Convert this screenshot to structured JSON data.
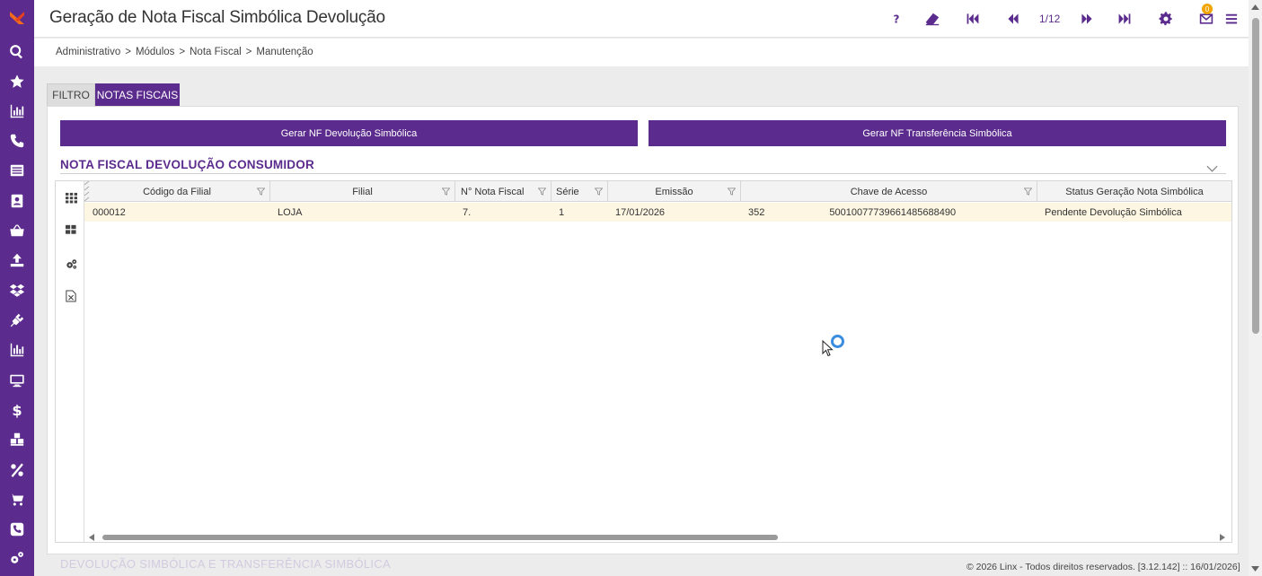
{
  "window": {
    "title": "Geração de Nota Fiscal Simbólica Devolução"
  },
  "toolbar": {
    "pager": "1/12",
    "notification_count": "0",
    "icons": [
      "help-icon",
      "eraser-icon",
      "first-page-icon",
      "previous-page-icon",
      "next-page-icon",
      "last-page-icon",
      "settings-icon",
      "mail-icon",
      "menu-icon"
    ]
  },
  "breadcrumb": {
    "items": [
      "Administrativo",
      "Módulos",
      "Nota Fiscal",
      "Manutenção"
    ],
    "separator": ">"
  },
  "tabs": [
    {
      "label": "FILTRO",
      "active": false
    },
    {
      "label": "NOTAS FISCAIS",
      "active": true
    }
  ],
  "actions": {
    "gerar_devolucao": "Gerar NF Devolução Simbólica",
    "gerar_transferencia": "Gerar NF Transferência Simbólica"
  },
  "section": {
    "title": "NOTA FISCAL DEVOLUÇÃO CONSUMIDOR"
  },
  "grid": {
    "columns": [
      "Código da Filial",
      "Filial",
      "N° Nota Fiscal",
      "Série",
      "Emissão",
      "Chave de Acesso",
      "Status Geração Nota Simbólica"
    ],
    "rows": [
      {
        "codigo": "000012",
        "filial": "LOJA",
        "nota": "7.",
        "serie": "1",
        "emissao": "17/01/2026",
        "chave": "352",
        "chave_end": "5001007773966148568849​0",
        "status": "Pendente Devolução Simbólica"
      }
    ]
  },
  "below_section": {
    "title": "DEVOLUÇÃO SIMBÓLICA E TRANSFERÊNCIA SIMBÓLICA"
  },
  "footer": {
    "text": "© 2026 Linx - Todos direitos reservados. [3.12.142] :: 16/01/2026]"
  },
  "colors": {
    "brand": "#5b2c8d",
    "row_highlight": "#fdf6e3",
    "badge": "#f0a500"
  }
}
